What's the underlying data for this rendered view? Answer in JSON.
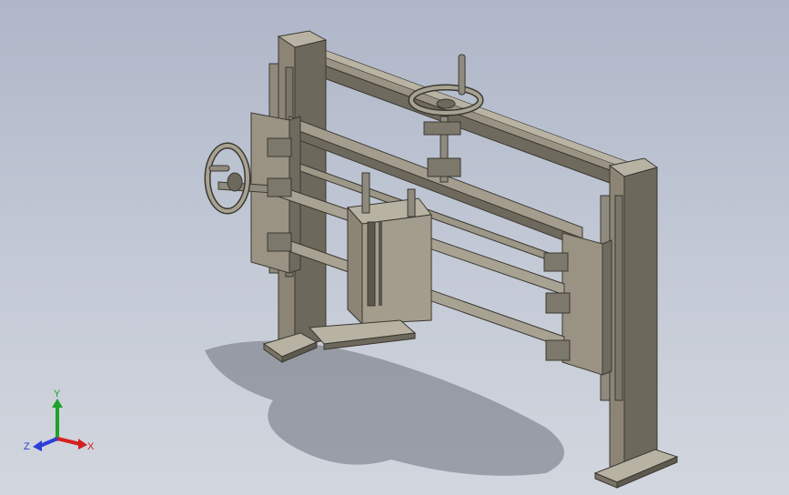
{
  "viewport": {
    "background_top": "#aeb6c8",
    "background_bottom": "#d2d6de",
    "part_color": "#8c8576",
    "part_dark": "#5e5a50",
    "part_light": "#b8b2a3"
  },
  "triad": {
    "x_label": "X",
    "y_label": "Y",
    "z_label": "Z",
    "x_color": "#d42020",
    "y_color": "#1fa12a",
    "z_color": "#2b3fd6"
  }
}
